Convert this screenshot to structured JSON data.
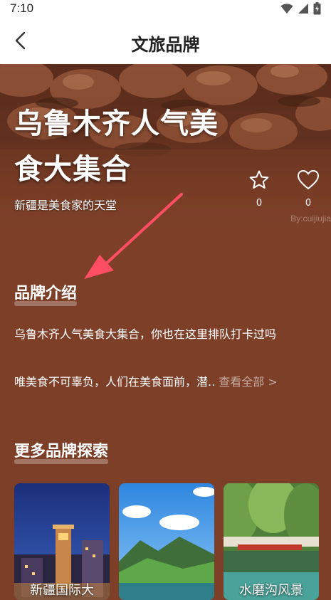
{
  "status_bar": {
    "time": "7:10"
  },
  "app_bar": {
    "title": "文旅品牌"
  },
  "hero": {
    "title_line1": "乌鲁木齐人气美",
    "title_line2": "食大集合",
    "subtitle": "新疆是美食家的天堂",
    "watermark": "By:cuijiujia",
    "favorite_count": "0",
    "like_count": "0"
  },
  "intro": {
    "title": "品牌介绍",
    "line1": "乌鲁木齐人气美食大集合，你也在这里排队打卡过吗",
    "line2": "唯美食不可辜负，人们在美食面前，潜.. ",
    "view_all": "查看全部 >"
  },
  "more": {
    "title": "更多品牌探索",
    "cards": [
      {
        "label": "新疆国际大"
      },
      {
        "label": ""
      },
      {
        "label": "水磨沟风景"
      }
    ]
  },
  "colors": {
    "background": "#7d3f28",
    "arrow": "#ff4d63"
  }
}
